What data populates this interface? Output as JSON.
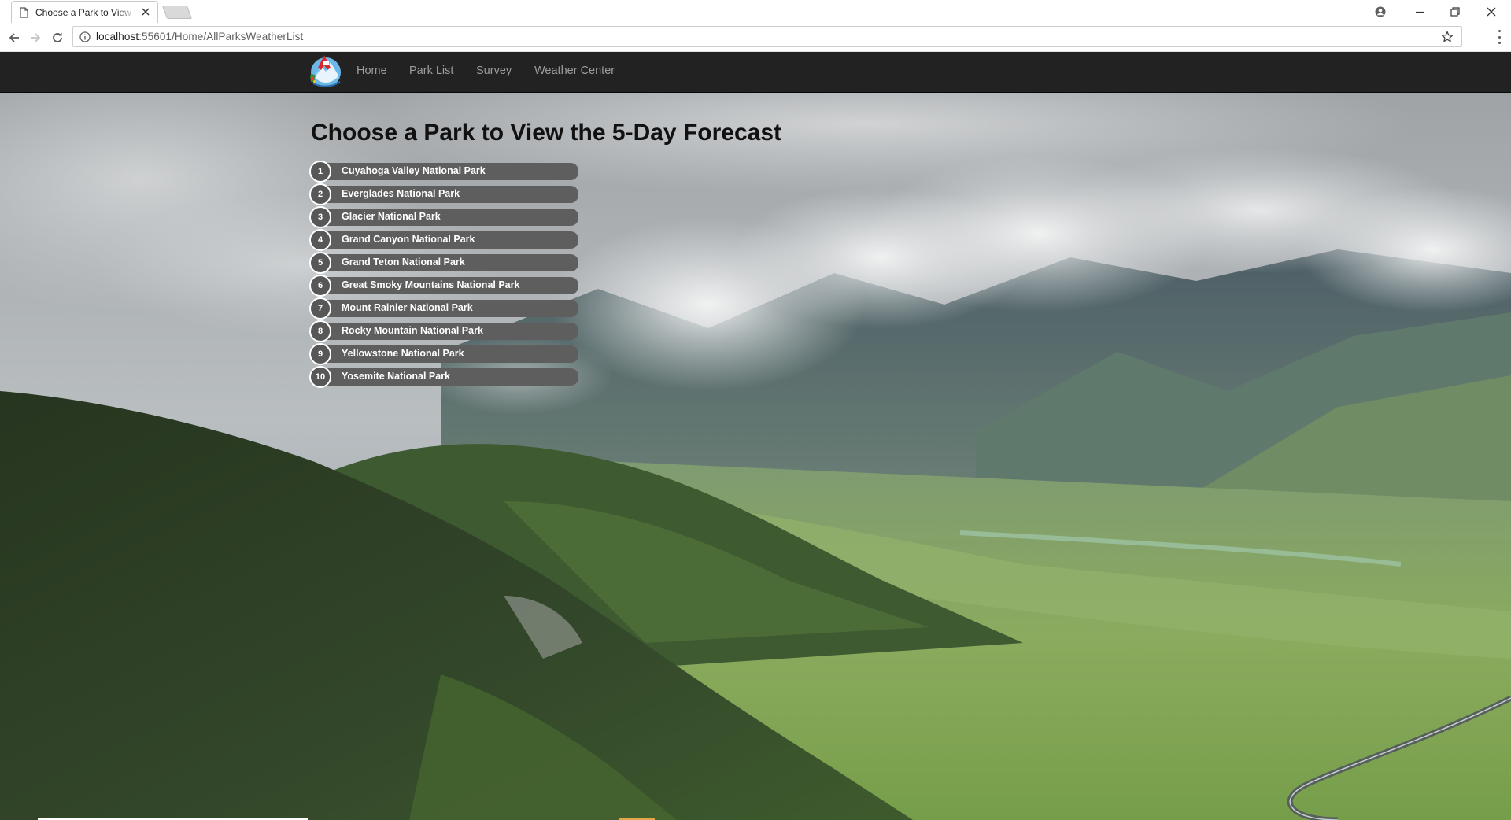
{
  "browser": {
    "tab_title": "Choose a Park to View the 5-Day Forecast",
    "url_host": "localhost",
    "url_path": ":55601/Home/AllParksWeatherList",
    "icons": [
      "page-icon",
      "close-icon",
      "back-arrow-icon",
      "forward-arrow-icon",
      "reload-icon",
      "info-icon",
      "star-icon",
      "menu-icon",
      "account-icon",
      "minimize-icon",
      "restore-icon",
      "window-close-icon"
    ]
  },
  "site": {
    "nav": {
      "items": [
        {
          "label": "Home"
        },
        {
          "label": "Park List"
        },
        {
          "label": "Survey"
        },
        {
          "label": "Weather Center"
        }
      ],
      "background": "#222222",
      "link_color": "#9d9d9d"
    },
    "page_title": "Choose a Park to View the 5-Day Forecast",
    "parks": [
      {
        "number": "1",
        "name": "Cuyahoga Valley National Park"
      },
      {
        "number": "2",
        "name": "Everglades National Park"
      },
      {
        "number": "3",
        "name": "Glacier National Park"
      },
      {
        "number": "4",
        "name": "Grand Canyon National Park"
      },
      {
        "number": "5",
        "name": "Grand Teton National Park"
      },
      {
        "number": "6",
        "name": "Great Smoky Mountains National Park"
      },
      {
        "number": "7",
        "name": "Mount Rainier National Park"
      },
      {
        "number": "8",
        "name": "Rocky Mountain National Park"
      },
      {
        "number": "9",
        "name": "Yellowstone National Park"
      },
      {
        "number": "10",
        "name": "Yosemite National Park"
      }
    ],
    "park_bar_color": "#5e5e5e"
  }
}
